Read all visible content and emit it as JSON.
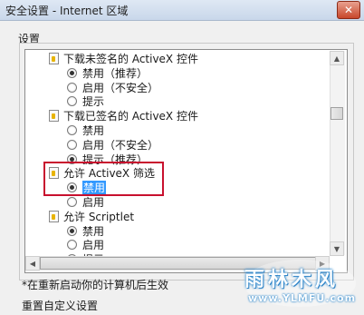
{
  "window": {
    "title": "安全设置 - Internet 区域",
    "close_label": "✕"
  },
  "settings_label": "设置",
  "list_items": [
    {
      "kind": "header",
      "label": "下载未签名的 ActiveX 控件"
    },
    {
      "kind": "option",
      "label": "禁用（推荐）",
      "checked": true
    },
    {
      "kind": "option",
      "label": "启用（不安全）",
      "checked": false
    },
    {
      "kind": "option",
      "label": "提示",
      "checked": false
    },
    {
      "kind": "header",
      "label": "下载已签名的 ActiveX 控件"
    },
    {
      "kind": "option",
      "label": "禁用",
      "checked": false
    },
    {
      "kind": "option",
      "label": "启用（不安全）",
      "checked": false
    },
    {
      "kind": "option",
      "label": "提示（推荐）",
      "checked": true
    },
    {
      "kind": "header",
      "label": "允许 ActiveX 筛选"
    },
    {
      "kind": "option",
      "label": "禁用",
      "checked": true,
      "selected": true
    },
    {
      "kind": "option",
      "label": "启用",
      "checked": false
    },
    {
      "kind": "header",
      "label": "允许 Scriptlet"
    },
    {
      "kind": "option",
      "label": "禁用",
      "checked": true
    },
    {
      "kind": "option",
      "label": "启用",
      "checked": false
    },
    {
      "kind": "option",
      "label": "提示",
      "checked": false
    }
  ],
  "footnote": "*在重新启动你的计算机后生效",
  "reset_label": "重置自定义设置",
  "watermark": {
    "text": "雨林木风",
    "url": "www.YLMFU.com"
  },
  "colors": {
    "highlight_box": "#c8102e",
    "selection": "#3399ff",
    "watermark": "#3a8fd0"
  }
}
